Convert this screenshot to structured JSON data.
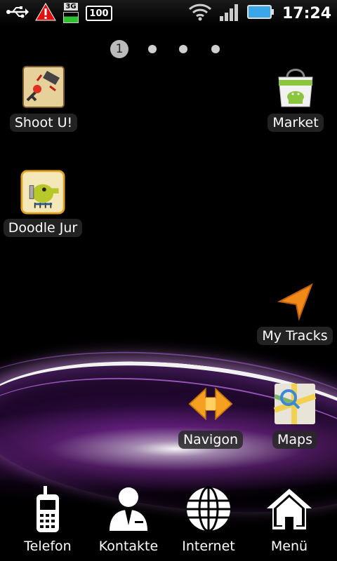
{
  "status_bar": {
    "icons": [
      "usb-icon",
      "warning-icon",
      "3g-data-icon",
      "battery-100-icon",
      "wifi-icon",
      "signal-icon",
      "battery-icon"
    ],
    "network_label": "3G",
    "battery_box": "100",
    "time": "17:24"
  },
  "pager": {
    "active_page": "1",
    "pages": 4
  },
  "apps": [
    {
      "label": "Shoot U!",
      "icon": "shoot-u-icon"
    },
    {
      "label": "Market",
      "icon": "market-icon"
    },
    {
      "label": "Doodle Jur",
      "icon": "doodle-jump-icon"
    },
    {
      "label": "My Tracks",
      "icon": "my-tracks-icon"
    },
    {
      "label": "Navigon",
      "icon": "navigon-icon"
    },
    {
      "label": "Maps",
      "icon": "maps-icon"
    }
  ],
  "dock": [
    {
      "label": "Telefon",
      "icon": "phone-icon"
    },
    {
      "label": "Kontakte",
      "icon": "contacts-icon"
    },
    {
      "label": "Internet",
      "icon": "globe-icon"
    },
    {
      "label": "Menü",
      "icon": "home-icon"
    }
  ],
  "colors": {
    "background": "#000000",
    "accent_purple": "#a040d0",
    "tracks_orange": "#f28a1a",
    "market_green": "#8cc63f"
  }
}
